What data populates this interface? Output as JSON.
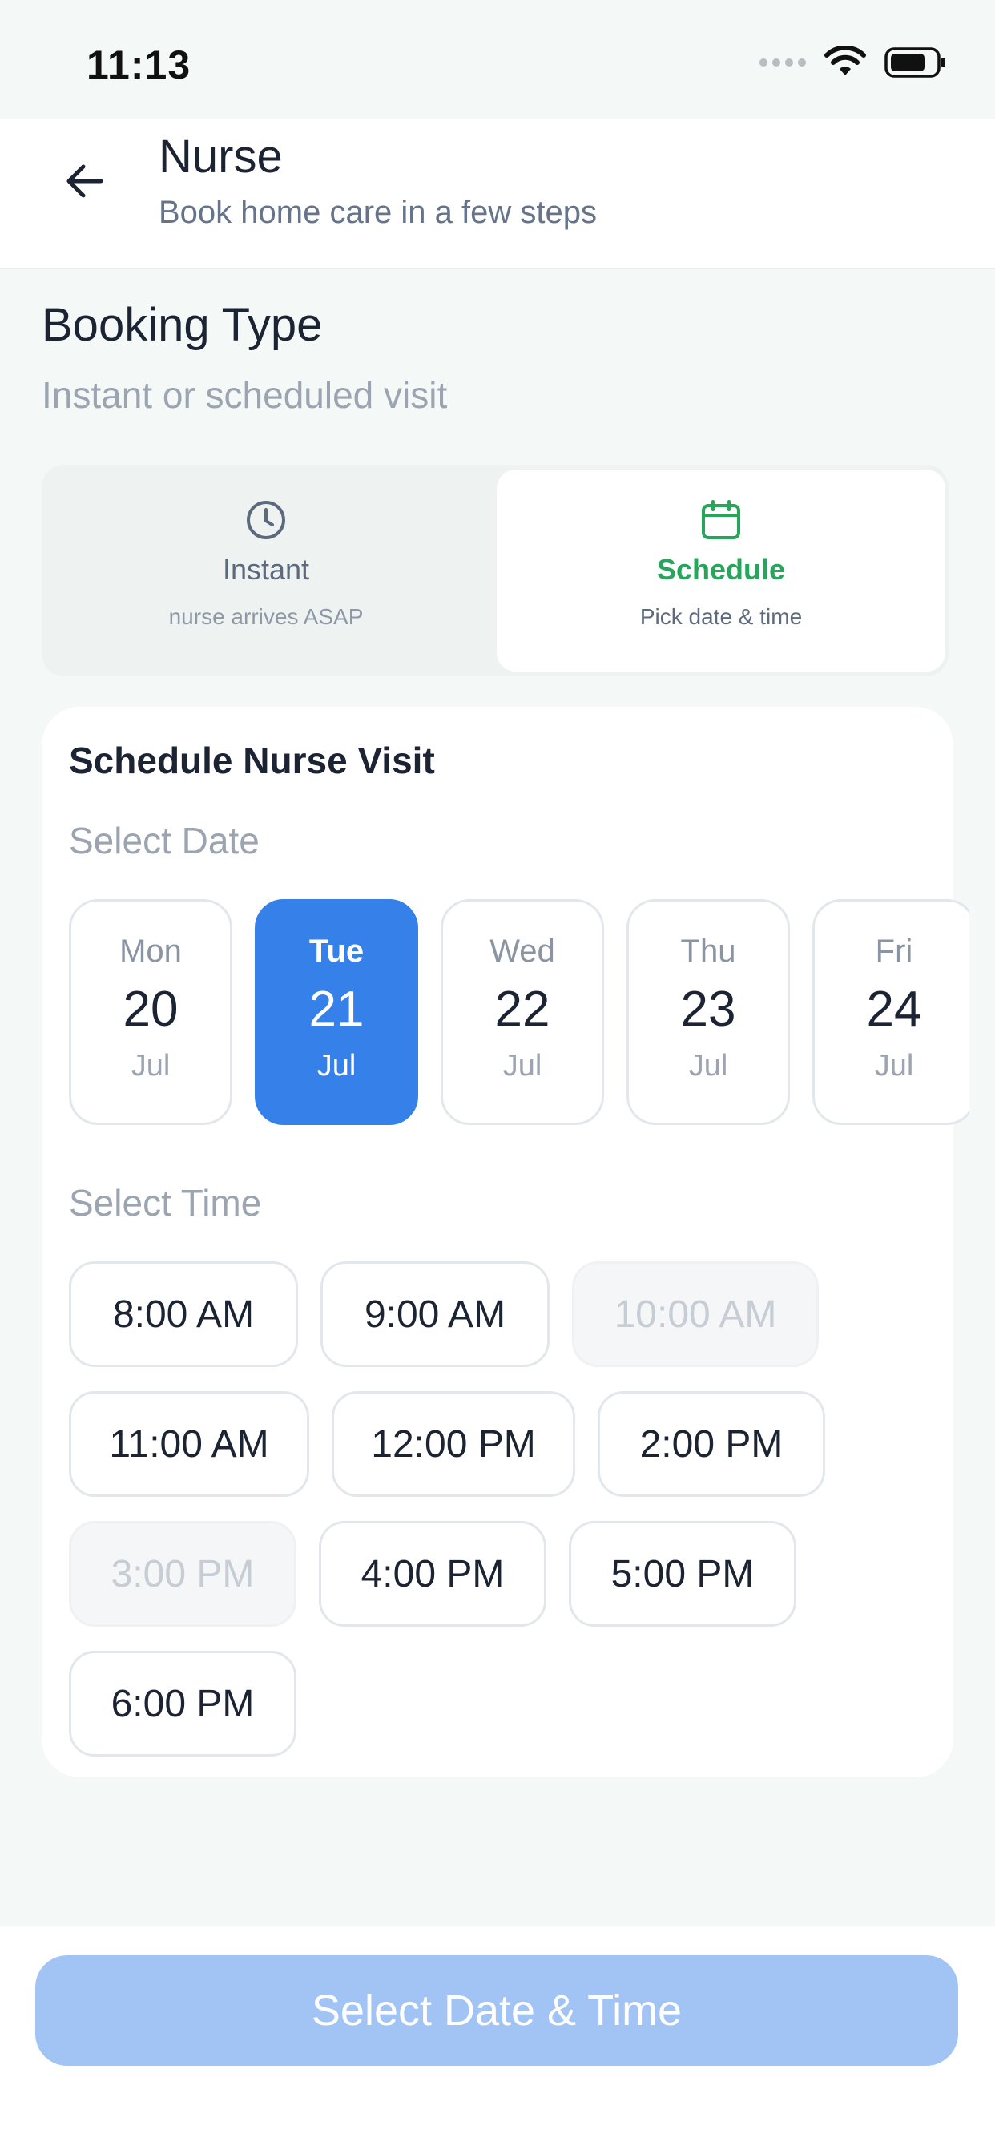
{
  "status": {
    "time": "11:13"
  },
  "header": {
    "title": "Nurse",
    "subtitle": "Book home care in a few steps"
  },
  "booking": {
    "title": "Booking Type",
    "subtitle": "Instant or scheduled visit",
    "options": [
      {
        "label": "Instant",
        "desc": "nurse arrives ASAP",
        "icon": "clock-icon",
        "selected": false
      },
      {
        "label": "Schedule",
        "desc": "Pick date & time",
        "icon": "calendar-icon",
        "selected": true
      }
    ]
  },
  "schedule": {
    "title": "Schedule Nurse Visit",
    "date_label": "Select Date",
    "time_label": "Select Time",
    "dates": [
      {
        "dow": "Mon",
        "day": "20",
        "mon": "Jul",
        "selected": false
      },
      {
        "dow": "Tue",
        "day": "21",
        "mon": "Jul",
        "selected": true
      },
      {
        "dow": "Wed",
        "day": "22",
        "mon": "Jul",
        "selected": false
      },
      {
        "dow": "Thu",
        "day": "23",
        "mon": "Jul",
        "selected": false
      },
      {
        "dow": "Fri",
        "day": "24",
        "mon": "Jul",
        "selected": false
      }
    ],
    "times": [
      {
        "label": "8:00 AM",
        "available": true
      },
      {
        "label": "9:00 AM",
        "available": true
      },
      {
        "label": "10:00 AM",
        "available": false
      },
      {
        "label": "11:00 AM",
        "available": true
      },
      {
        "label": "12:00 PM",
        "available": true
      },
      {
        "label": "2:00 PM",
        "available": true
      },
      {
        "label": "3:00 PM",
        "available": false
      },
      {
        "label": "4:00 PM",
        "available": true
      },
      {
        "label": "5:00 PM",
        "available": true
      },
      {
        "label": "6:00 PM",
        "available": true
      }
    ]
  },
  "footer": {
    "cta_label": "Select Date & Time",
    "cta_enabled": false
  },
  "colors": {
    "accent": "#3680ea",
    "success": "#26a65b",
    "cta_disabled": "#a2c4f5"
  }
}
